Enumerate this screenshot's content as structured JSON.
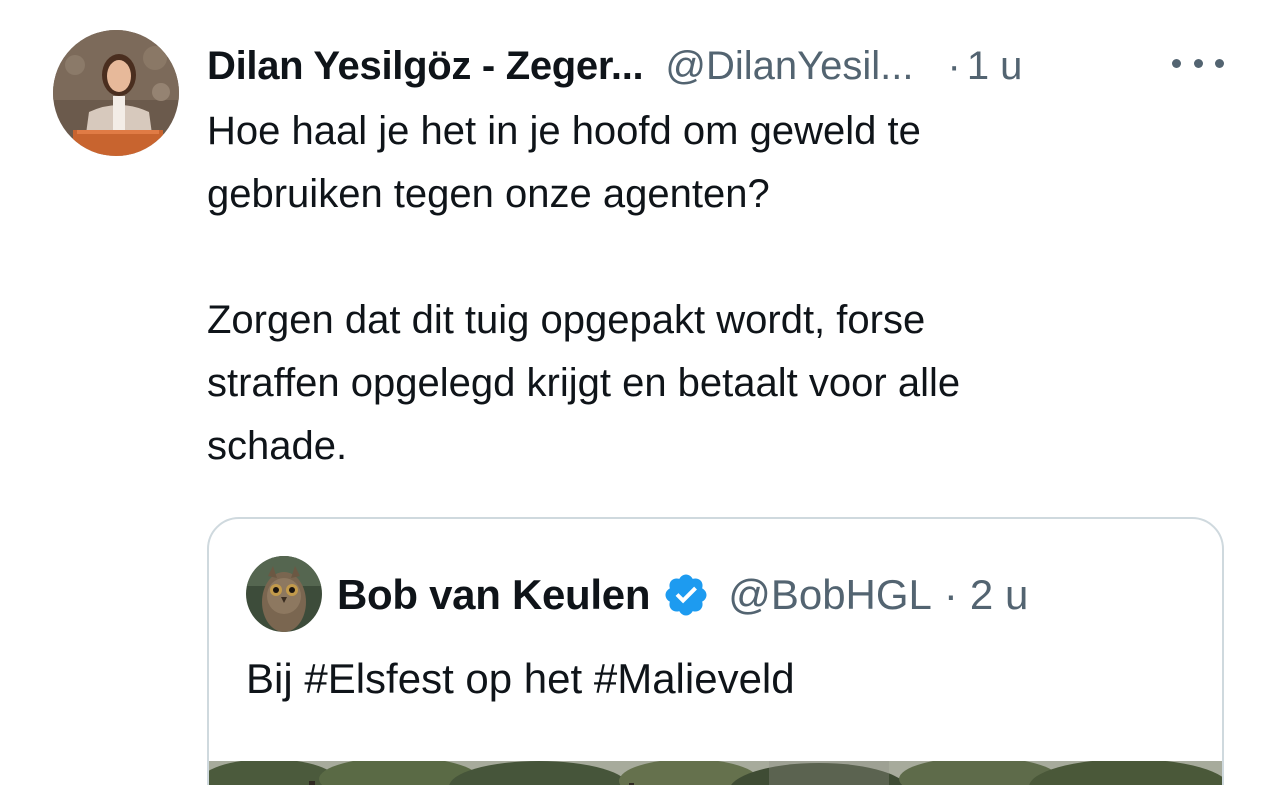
{
  "tweet": {
    "author_name": "Dilan Yesilgöz - Zeger...",
    "author_handle": "@DilanYesil...",
    "separator": "·",
    "time": "1 u",
    "more_icon": "more-horizontal-icon",
    "paragraphs": [
      "Hoe haal je het in je hoofd om geweld te\ngebruiken tegen onze agenten?",
      "Zorgen dat dit tuig opgepakt wordt, forse\nstraffen opgelegd krijgt en betaalt voor alle\nschade."
    ]
  },
  "quoted_tweet": {
    "author_name": "Bob van Keulen",
    "verified_icon": "verified-badge-icon",
    "author_handle": "@BobHGL",
    "separator": "·",
    "time": "2 u",
    "text": "Bij #Elsfest op het #Malieveld"
  },
  "colors": {
    "text_primary": "#0f1419",
    "text_secondary": "#536471",
    "border": "#cfd9de",
    "verified_blue": "#1d9bf0"
  }
}
